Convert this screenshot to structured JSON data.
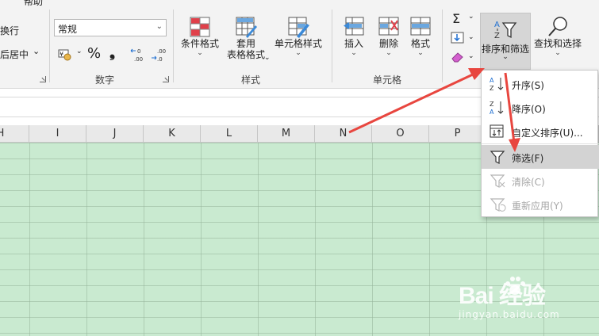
{
  "ribbon": {
    "top_text": "帮助",
    "alignment": {
      "wrap_label": "换行",
      "merge_label": "后居中",
      "merge_caret": "⌄"
    },
    "number": {
      "format_value": "常规",
      "currency_symbol": "¥",
      "percent_symbol": "%",
      "comma_symbol": "❟",
      "increase_decimal": ".00→.0",
      "decrease_decimal": ".0→.00",
      "group_label": "数字"
    },
    "styles": {
      "conditional_format": "条件格式",
      "table_format_line1": "套用",
      "table_format_line2": "表格格式",
      "cell_styles": "单元格样式",
      "group_label": "样式"
    },
    "cells": {
      "insert": "插入",
      "delete": "删除",
      "format": "格式",
      "group_label": "单元格"
    },
    "editing": {
      "sort_filter": "排序和筛选",
      "find_select": "查找和选择",
      "caret": "⌄"
    }
  },
  "columns": [
    "H",
    "I",
    "J",
    "K",
    "L",
    "M",
    "N",
    "O",
    "P"
  ],
  "menu": {
    "items": [
      {
        "label": "升序(S)",
        "icon": "sort-ascending-icon",
        "enabled": true
      },
      {
        "label": "降序(O)",
        "icon": "sort-descending-icon",
        "enabled": true
      },
      {
        "label": "自定义排序(U)...",
        "icon": "custom-sort-icon",
        "enabled": true
      },
      {
        "label": "筛选(F)",
        "icon": "filter-icon",
        "enabled": true,
        "highlighted": true
      },
      {
        "label": "清除(C)",
        "icon": "clear-filter-icon",
        "enabled": false
      },
      {
        "label": "重新应用(Y)",
        "icon": "reapply-filter-icon",
        "enabled": false
      }
    ]
  },
  "colors": {
    "grid_fill": "#c9ead0",
    "annotation_arrow": "#e8463f",
    "menu_highlight": "#d3d3d3"
  },
  "watermark": {
    "brand": "Bai 经验",
    "url": "jingyan.baidu.com"
  }
}
